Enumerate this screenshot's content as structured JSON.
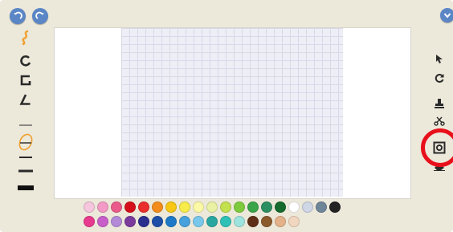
{
  "toolbar_top": {
    "undo_icon": "undo-icon",
    "redo_icon": "redo-icon",
    "menu_icon": "chevron-down-icon"
  },
  "left_tools": [
    "freehand-icon",
    "circle-icon",
    "rectangle-icon",
    "triangle-icon",
    "thin-line-icon",
    "selected-pen-icon",
    "medium-line-icon",
    "thick-line-icon",
    "extra-thick-line-icon"
  ],
  "right_tools": [
    "pointer-icon",
    "rotate-icon",
    "stamp-icon",
    "scissors-icon",
    "camera-icon",
    "eraser-icon"
  ],
  "colors": {
    "accent": "#5a86c6",
    "annotation": "#e8101a",
    "frame": "#ece8da",
    "grid": "#eeeef6"
  },
  "palette": {
    "row1": [
      "#f5c6dd",
      "#f39ac7",
      "#ea5a8a",
      "#d5101a",
      "#ea2d2d",
      "#f38c1b",
      "#f7c714",
      "#f7ec4a",
      "#fcf9a6",
      "#e9f2a4",
      "#c3e04d",
      "#7dcb3c",
      "#3aa449",
      "#2b8f62",
      "#146b2d",
      "#ffffff",
      "#cfd6e6",
      "#6f8598",
      "#222222"
    ],
    "row2": [
      "#e83a8f",
      "#c85ec9",
      "#b38ad8",
      "#7b3b9c",
      "#2a2f8e",
      "#1e4fa8",
      "#1d79c7",
      "#46a1dc",
      "#79c8eb",
      "#2aa6a0",
      "#2fc1b7",
      "#9de4df",
      "#5e2f16",
      "#8b5a2b",
      "#e3b28a",
      "#f2d7c0"
    ]
  }
}
